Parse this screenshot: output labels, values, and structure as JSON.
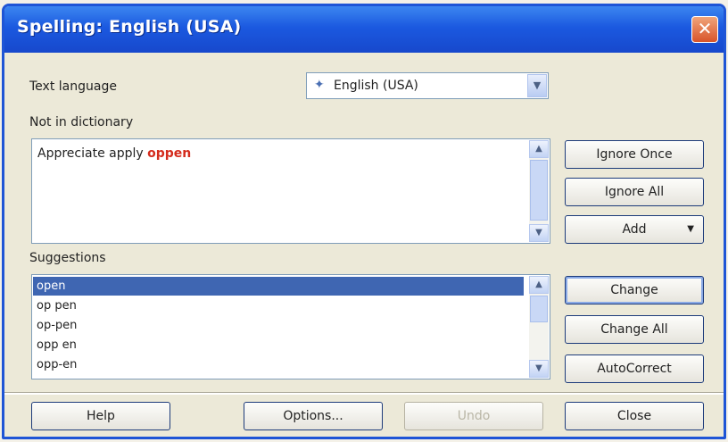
{
  "window": {
    "title": "Spelling: English (USA)",
    "close": "✕"
  },
  "language": {
    "label": "Text language",
    "value": "English (USA)"
  },
  "not_in_dictionary": {
    "label": "Not in dictionary",
    "text_plain": "Appreciate apply ",
    "text_error": "oppen"
  },
  "suggestions": {
    "label": "Suggestions",
    "items": [
      "open",
      "op pen",
      "op-pen",
      "opp en",
      "opp-en"
    ],
    "selected_index": 0
  },
  "side_buttons": {
    "ignore_once": "Ignore Once",
    "ignore_all": "Ignore All",
    "add": "Add",
    "change": "Change",
    "change_all": "Change All",
    "autocorrect": "AutoCorrect"
  },
  "bottom_buttons": {
    "help": "Help",
    "options": "Options...",
    "undo": "Undo",
    "close": "Close"
  },
  "colors": {
    "titlebar": "#1b59e0",
    "error_text": "#d42b1c",
    "selection": "#3f66b2"
  },
  "icons": {
    "language_flag": "flag-icon",
    "dropdown": "chevron-down-icon"
  }
}
